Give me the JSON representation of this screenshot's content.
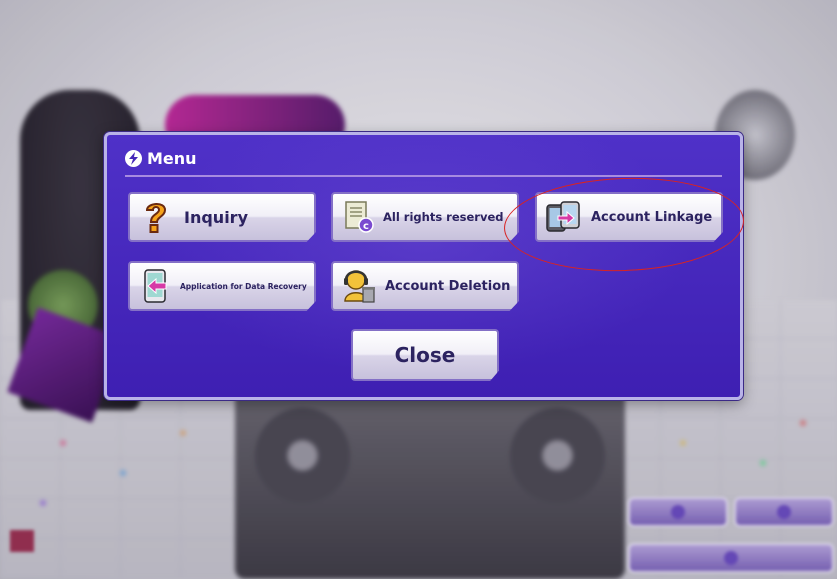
{
  "modal": {
    "title": "Menu",
    "title_icon": "lightning-bolt-icon"
  },
  "buttons": [
    {
      "label": "Inquiry",
      "icon": "question-mark-icon"
    },
    {
      "label": "All rights reserved",
      "icon": "document-copyright-icon"
    },
    {
      "label": "Account Linkage",
      "icon": "device-transfer-icon"
    },
    {
      "label": "Application for Data Recovery",
      "icon": "phone-recovery-icon"
    },
    {
      "label": "Account Deletion",
      "icon": "headset-trash-icon"
    }
  ],
  "close_label": "Close",
  "colors": {
    "modal_bg": "#4526b8",
    "modal_border": "#b9b3e8",
    "button_text": "#2c2360",
    "annotation": "#d82323"
  }
}
